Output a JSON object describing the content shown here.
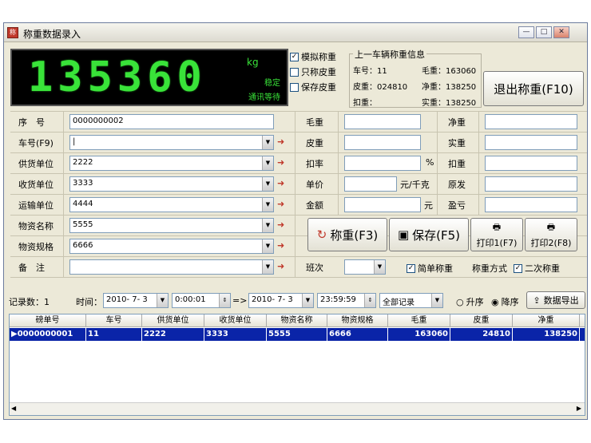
{
  "window": {
    "title": "称重数据录入",
    "min": "—",
    "max": "□",
    "close": "✕"
  },
  "display": {
    "weight": "135360",
    "unit": "kg",
    "status": "稳定",
    "comm": "通讯等待"
  },
  "options": [
    {
      "label": "模拟称重",
      "checked": true
    },
    {
      "label": "只称皮重",
      "checked": false
    },
    {
      "label": "保存皮重",
      "checked": false
    }
  ],
  "last_info": {
    "legend": "上一车辆称重信息",
    "plate": "车号：11",
    "gross": "毛重：163060",
    "tare": "皮重：024810",
    "net": "净重：138250",
    "deduct": "扣重：",
    "actual": "实重：138250"
  },
  "exit_button": "退出称重(F10)",
  "fields": {
    "serial": {
      "label": "序　号",
      "value": "0000000002"
    },
    "plate": {
      "label": "车号(F9)",
      "value": "|"
    },
    "supplier": {
      "label": "供货单位",
      "value": "2222"
    },
    "receiver": {
      "label": "收货单位",
      "value": "3333"
    },
    "transport": {
      "label": "运输单位",
      "value": "4444"
    },
    "material": {
      "label": "物资名称",
      "value": "5555"
    },
    "spec": {
      "label": "物资规格",
      "value": "6666"
    },
    "remark": {
      "label": "备　注",
      "value": ""
    }
  },
  "mid": {
    "gross": "毛重",
    "tare": "皮重",
    "deduct_rate": "扣率",
    "percent": "%",
    "price": "单价",
    "price_unit": "元/千克",
    "amount": "金额",
    "amount_unit": "元",
    "shift": "班次"
  },
  "right": {
    "net": "净重",
    "actual": "实重",
    "deduct": "扣重",
    "origin": "原发",
    "surplus": "盈亏"
  },
  "buttons": {
    "weigh": "称重(F3)",
    "save": "保存(F5)",
    "print1": "打印1(F7)",
    "print2": "打印2(F8)"
  },
  "mode": {
    "simple": "简单称重",
    "method": "称重方式",
    "second": "二次称重"
  },
  "filter": {
    "count": "记录数：1",
    "time_label": "时间：",
    "date_from": "2010- 7- 3",
    "time_from": "0:00:01",
    "arrow": "=>",
    "date_to": "2010- 7- 3",
    "time_to": "23:59:59",
    "scope": "全部记录",
    "asc": "升序",
    "desc": "降序",
    "export": "数据导出"
  },
  "table": {
    "columns": [
      "磅单号",
      "车号",
      "供货单位",
      "收货单位",
      "物资名称",
      "物资规格",
      "毛重",
      "皮重",
      "净重"
    ],
    "rows": [
      [
        "0000000001",
        "11",
        "2222",
        "3333",
        "5555",
        "6666",
        "163060",
        "24810",
        "138250"
      ]
    ]
  },
  "colors": {
    "led": "#39e339",
    "selected_row": "#0a24a8"
  }
}
